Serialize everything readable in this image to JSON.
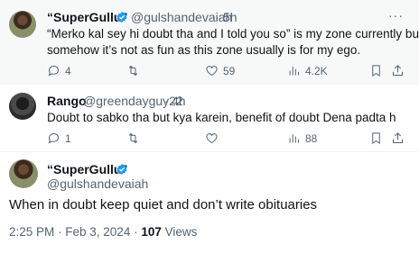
{
  "tweets": [
    {
      "name": "“SuperGullu”",
      "handle": "@gulshandevaiah",
      "time": "5h",
      "text_lines": [
        "“Merko kal sey hi doubt tha and I told you so” is my zone currently but",
        "somehow it’s not as fun as this zone usually is for my ego."
      ],
      "actions": {
        "replies": "4",
        "reposts": "",
        "likes": "59",
        "views": "4.2K"
      }
    },
    {
      "name": "Rango",
      "handle": "@greendayguy22",
      "time": "4h",
      "text_lines": [
        "Doubt to sabko tha but kya karein, benefit of doubt Dena padta h"
      ],
      "actions": {
        "replies": "1",
        "reposts": "",
        "likes": "",
        "views": "88"
      }
    }
  ],
  "main_tweet": {
    "name": "“SuperGullu”",
    "handle": "@gulshandevaiah",
    "text": "When in doubt keep quiet and don’t write obituaries",
    "time": "2:25 PM · Feb 3, 2024 · ",
    "views_count": "107",
    "views_label": " Views"
  },
  "colors": {
    "verified": "#1d9bf0",
    "secondary_text": "#536471",
    "highlight_bg": "#f7f9f9"
  },
  "icons": [
    "verified-badge-icon",
    "more-icon",
    "reply-icon",
    "repost-icon",
    "like-icon",
    "views-icon",
    "bookmark-icon",
    "share-icon"
  ]
}
